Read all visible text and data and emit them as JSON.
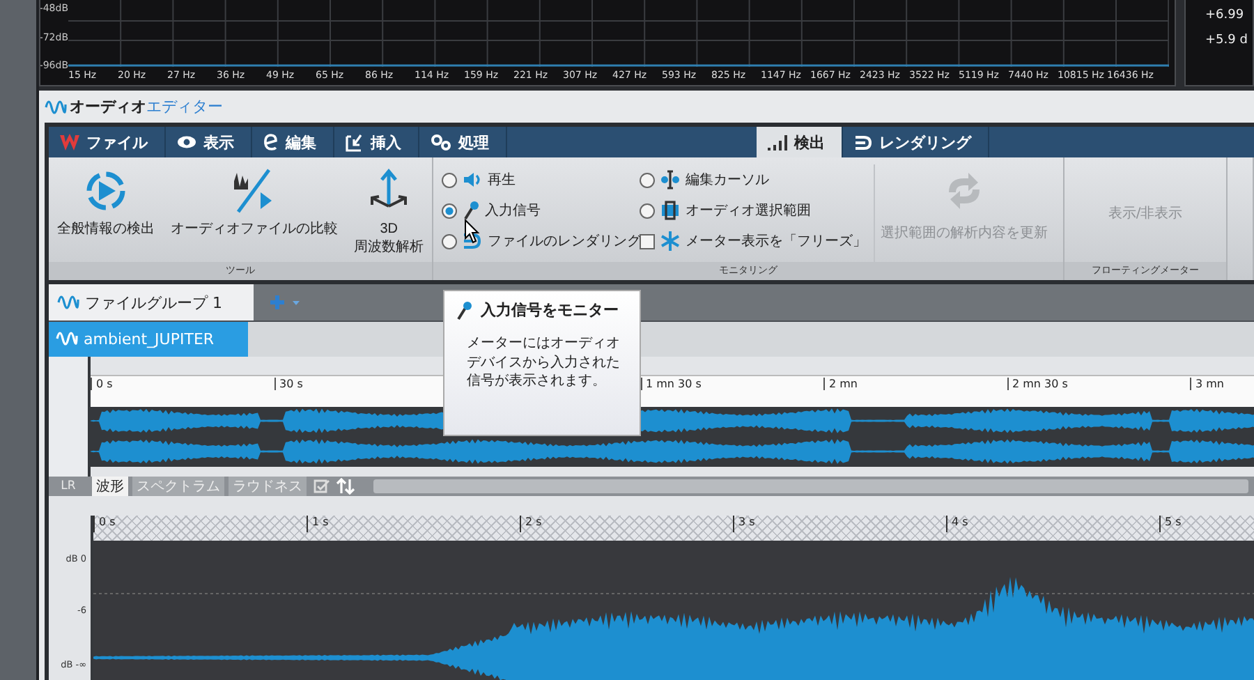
{
  "spectrum": {
    "db_labels": [
      "-48dB",
      "-72dB",
      "-96dB"
    ],
    "freq_labels": [
      "15 Hz",
      "20 Hz",
      "27 Hz",
      "36 Hz",
      "49 Hz",
      "65 Hz",
      "86 Hz",
      "114 Hz",
      "159 Hz",
      "221 Hz",
      "307 Hz",
      "427 Hz",
      "593 Hz",
      "825 Hz",
      "1147 Hz",
      "1667 Hz",
      "2423 Hz",
      "3522 Hz",
      "5119 Hz",
      "7440 Hz",
      "10815 Hz",
      "16436 Hz"
    ]
  },
  "side_readout": [
    "+6.99",
    "+5.9 d"
  ],
  "editor": {
    "title_1": "オーディオ",
    "title_2": "エディター"
  },
  "menu_tabs": [
    {
      "label": "ファイル",
      "selected": false
    },
    {
      "label": "表示",
      "selected": false
    },
    {
      "label": "編集",
      "selected": false
    },
    {
      "label": "挿入",
      "selected": false
    },
    {
      "label": "処理",
      "selected": false
    },
    {
      "label": "検出",
      "selected": true
    },
    {
      "label": "レンダリング",
      "selected": false
    }
  ],
  "ribbon": {
    "tools": {
      "buttons": [
        {
          "label": "全般情報の検出"
        },
        {
          "label": "オーディオファイルの比較"
        },
        {
          "label": "3D\n周波数解析"
        }
      ],
      "group_label": "ツール"
    },
    "monitoring": {
      "options": [
        {
          "kind": "radio",
          "label": "再生",
          "selected": false
        },
        {
          "kind": "radio",
          "label": "入力信号",
          "selected": true
        },
        {
          "kind": "radio",
          "label": "ファイルのレンダリング",
          "selected": false
        },
        {
          "kind": "radio",
          "label": "編集カーソル",
          "selected": false
        },
        {
          "kind": "radio",
          "label": "オーディオ選択範囲",
          "selected": false
        },
        {
          "kind": "checkbox",
          "label": "メーター表示を「フリーズ」",
          "checked": false
        }
      ],
      "update_button": {
        "label": "選択範囲の解析内容を更新",
        "disabled": true
      },
      "group_label": "モニタリング"
    },
    "floating": {
      "button": {
        "label": "表示/非表示",
        "disabled": true
      },
      "group_label": "フローティングメーター"
    }
  },
  "group_tabs": [
    {
      "label": "ファイルグループ 1",
      "selected": true
    }
  ],
  "file_tab": {
    "label": "ambient_JUPITER",
    "selected": true
  },
  "tooltip": {
    "title": "入力信号をモニター",
    "body": "メーターにはオーディオデバイスから入力された信号が表示されます。"
  },
  "overview": {
    "ruler": [
      "0 s",
      "30 s",
      "1 mn 30 s",
      "2 mn",
      "2 mn 30 s",
      "3 mn"
    ]
  },
  "view_tabs": {
    "channel_label": "LR",
    "tabs": [
      {
        "label": "波形",
        "selected": true
      },
      {
        "label": "スペクトラム",
        "selected": false
      },
      {
        "label": "ラウドネス",
        "selected": false
      }
    ]
  },
  "main": {
    "ruler": [
      "0 s",
      "1 s",
      "2 s",
      "3 s",
      "4 s",
      "5 s"
    ],
    "db_labels": [
      "dB 0",
      "-6",
      "dB -∞"
    ]
  }
}
